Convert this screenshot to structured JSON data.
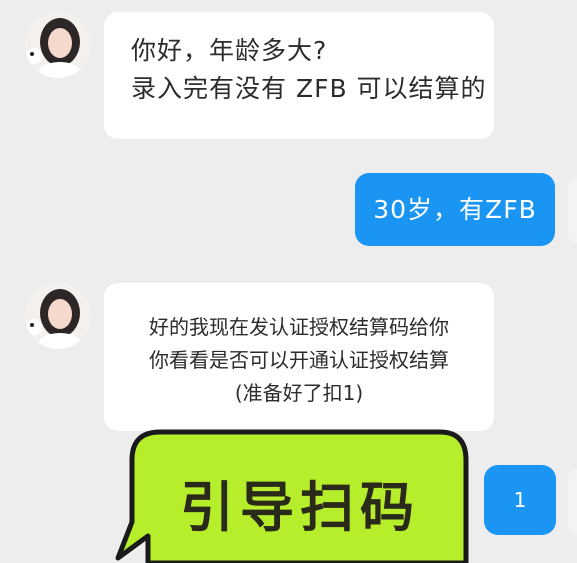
{
  "messages": [
    {
      "side": "in",
      "lines": [
        "你好，年龄多大?",
        "录入完有没有 ZFB 可以结算的"
      ]
    },
    {
      "side": "out",
      "text": "30岁，有ZFB"
    },
    {
      "side": "in",
      "lines": [
        "好的我现在发认证授权结算码给你",
        "你看看是否可以开通认证授权结算",
        "(准备好了扣1)"
      ]
    },
    {
      "side": "out",
      "text": "1"
    }
  ],
  "callout": {
    "text": "引导扫码"
  },
  "colors": {
    "background": "#ededed",
    "outgoing": "#1b95f4",
    "incoming": "#ffffff",
    "callout_fill": "#b6ee2c"
  }
}
